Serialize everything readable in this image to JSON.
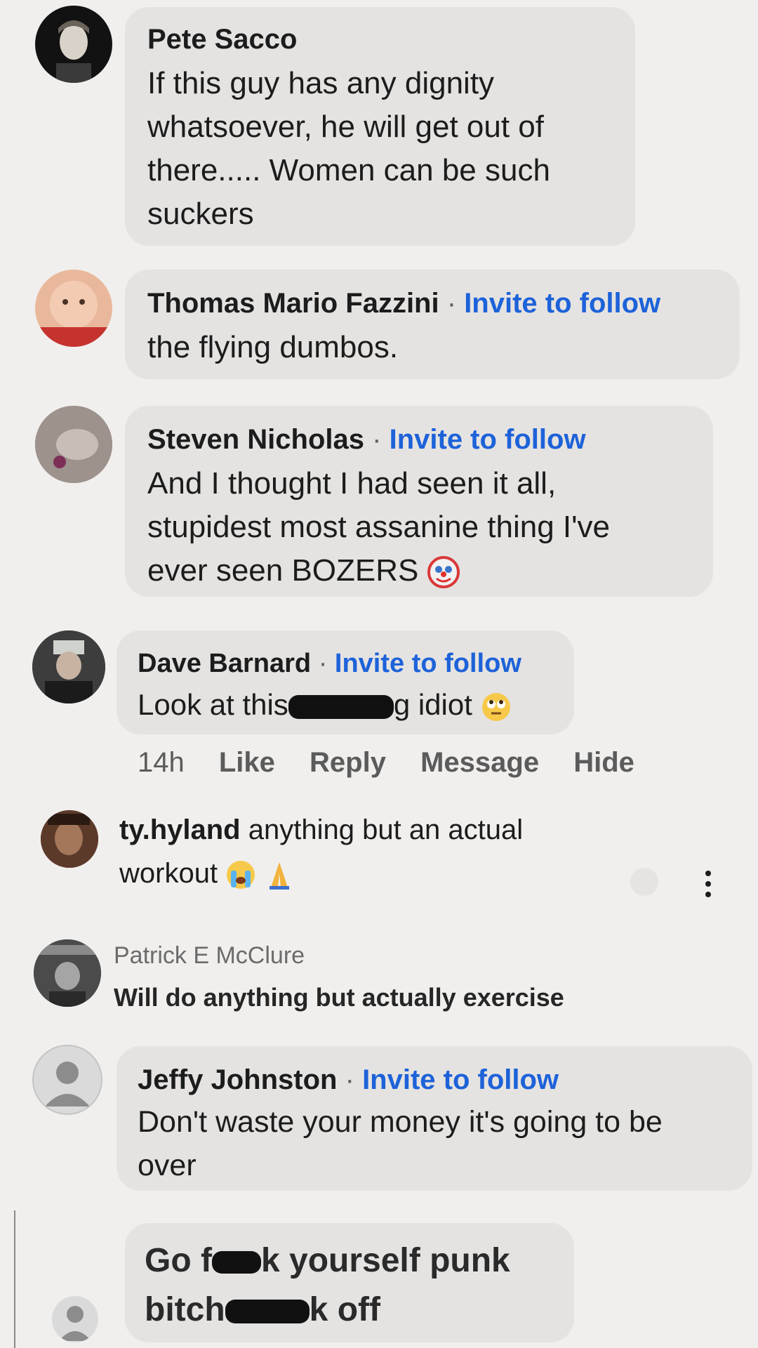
{
  "comments": [
    {
      "author": "Pete Sacco",
      "lines": [
        "If this guy has any dignity",
        "whatsoever, he will get out of",
        "there..... Women can be such",
        "suckers"
      ]
    },
    {
      "author": "Thomas Mario Fazzini",
      "separator": "·",
      "follow": "Invite to follow",
      "lines": [
        "the flying dumbos."
      ]
    },
    {
      "author": "Steven Nicholas",
      "separator": "·",
      "follow": "Invite to follow",
      "lines": [
        "And I thought I had seen it all,",
        "stupidest most assanine thing I've",
        "ever seen BOZERS"
      ],
      "emoji": "clown-face"
    },
    {
      "author": "Dave Barnard",
      "separator": "·",
      "follow": "Invite to follow",
      "text_before": "Look at this",
      "text_after": "g idiot",
      "emoji": "rolling-eyes-face",
      "actions": {
        "time": "14h",
        "like": "Like",
        "reply": "Reply",
        "message": "Message",
        "hide": "Hide"
      }
    },
    {
      "author": "ty.hyland",
      "text": "anything but an actual",
      "line2": "workout",
      "emojis": [
        "loudly-crying-face",
        "folded-hands"
      ]
    },
    {
      "author": "Patrick E McClure",
      "text": "Will do anything but actually exercise"
    },
    {
      "author": "Jeffy Johnston",
      "separator": "·",
      "follow": "Invite to follow",
      "lines": [
        "Don't waste your money it's going to be",
        "over"
      ]
    },
    {
      "line1_before": "Go f",
      "line1_after": "k yourself punk",
      "line2_before": "bitch",
      "line2_after": "k off"
    }
  ],
  "colors": {
    "background": "#f1efed",
    "bubble": "#e5e3e1",
    "link": "#1d62d9"
  }
}
